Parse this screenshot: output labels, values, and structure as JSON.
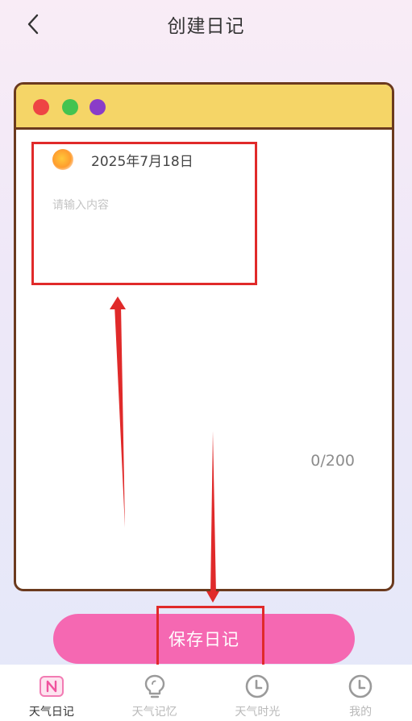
{
  "header": {
    "title": "创建日记",
    "back_icon": "chevron-left-icon"
  },
  "window": {
    "dot_colors": [
      "#ee4444",
      "#44c350",
      "#8a3cc8"
    ],
    "bar_color": "#f5d567",
    "border_color": "#6b3a1e"
  },
  "diary": {
    "date": "2025年7月18日",
    "weather_icon": "sun-icon",
    "content_value": "",
    "content_placeholder": "请输入内容",
    "char_count": "0/200"
  },
  "save_button": {
    "label": "保存日记",
    "color": "#f568b2"
  },
  "tabbar": {
    "items": [
      {
        "label": "天气日记",
        "icon": "diary-n-icon",
        "active": true
      },
      {
        "label": "天气记忆",
        "icon": "lightbulb-icon",
        "active": false
      },
      {
        "label": "天气时光",
        "icon": "clock-icon",
        "active": false
      },
      {
        "label": "我的",
        "icon": "clock-icon",
        "active": false
      }
    ]
  },
  "annotation": {
    "highlight_color": "#e02a2a"
  }
}
